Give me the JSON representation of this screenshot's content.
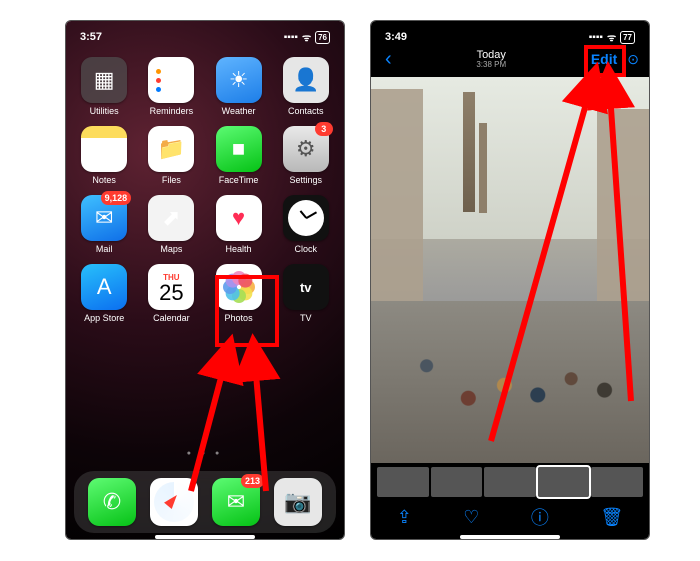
{
  "left": {
    "status": {
      "time": "3:57",
      "signal": "▪▪▪▪",
      "wifi": "ᯤ",
      "battery": "76"
    },
    "apps": [
      {
        "label": "Utilities",
        "cls": "ic-utilities",
        "icon": "▦"
      },
      {
        "label": "Reminders",
        "cls": "ic-reminders",
        "icon": ""
      },
      {
        "label": "Weather",
        "cls": "ic-weather",
        "icon": "☀"
      },
      {
        "label": "Contacts",
        "cls": "ic-contacts",
        "icon": "👤"
      },
      {
        "label": "Notes",
        "cls": "ic-notes",
        "icon": ""
      },
      {
        "label": "Files",
        "cls": "ic-files",
        "icon": "📁"
      },
      {
        "label": "FaceTime",
        "cls": "ic-facetime",
        "icon": "■"
      },
      {
        "label": "Settings",
        "cls": "ic-settings",
        "icon": "⚙",
        "badge": "3"
      },
      {
        "label": "Mail",
        "cls": "ic-mail",
        "icon": "✉",
        "badge": "9,128"
      },
      {
        "label": "Maps",
        "cls": "ic-maps",
        "icon": "⬈"
      },
      {
        "label": "Health",
        "cls": "ic-health",
        "icon": "♥"
      },
      {
        "label": "Clock",
        "cls": "ic-clock",
        "icon": "◴"
      },
      {
        "label": "App Store",
        "cls": "ic-appstore",
        "icon": "A"
      },
      {
        "label": "Calendar",
        "cls": "ic-calendar",
        "icon": ""
      },
      {
        "label": "Photos",
        "cls": "ic-photos",
        "icon": ""
      },
      {
        "label": "TV",
        "cls": "ic-tv",
        "icon": "tv"
      }
    ],
    "calendar": {
      "weekday": "THU",
      "day": "25"
    },
    "dots": "● ● ●",
    "dock": [
      {
        "label": "Phone",
        "cls": "ic-phone",
        "icon": "✆"
      },
      {
        "label": "Safari",
        "cls": "ic-safari",
        "icon": "◉"
      },
      {
        "label": "Messages",
        "cls": "ic-messages",
        "icon": "✉",
        "badge": "213"
      },
      {
        "label": "Camera",
        "cls": "ic-camera",
        "icon": "📷"
      }
    ]
  },
  "right": {
    "status": {
      "time": "3:49",
      "signal": "▪▪▪▪",
      "wifi": "ᯤ",
      "battery": "77"
    },
    "nav": {
      "back": "‹",
      "title": "Today",
      "subtitle": "3:38 PM",
      "edit": "Edit",
      "more": "⊙"
    },
    "toolbar": {
      "share": "⇪",
      "heart": "♡",
      "info": "ⓘ",
      "trash": "🗑"
    }
  }
}
